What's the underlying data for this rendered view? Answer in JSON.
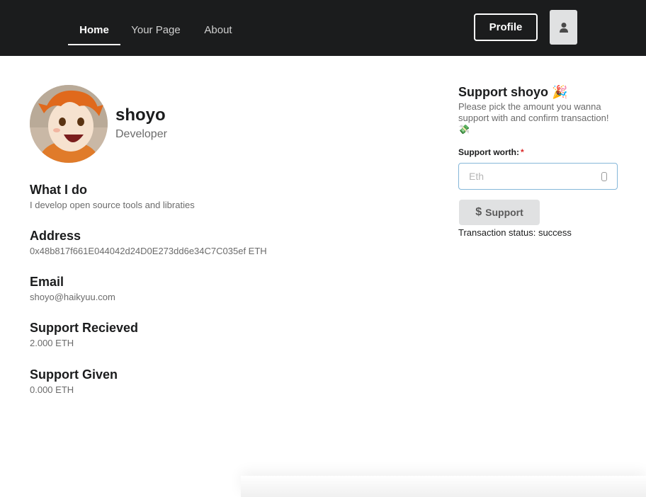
{
  "nav": {
    "items": [
      {
        "label": "Home",
        "active": true
      },
      {
        "label": "Your Page",
        "active": false
      },
      {
        "label": "About",
        "active": false
      }
    ],
    "profile_label": "Profile",
    "user_icon": "user-icon"
  },
  "profile": {
    "name": "shoyo",
    "role": "Developer",
    "avatar": "avatar-image"
  },
  "sections": [
    {
      "title": "What I do",
      "value": "I develop open source tools and libraties"
    },
    {
      "title": "Address",
      "value": "0x48b817f661E044042d24D0E273dd6e34C7C035ef ETH"
    },
    {
      "title": "Email",
      "value": "shoyo@haikyuu.com"
    },
    {
      "title": "Support Recieved",
      "value": "2.000 ETH"
    },
    {
      "title": "Support Given",
      "value": "0.000 ETH"
    }
  ],
  "support": {
    "title": "Support shoyo 🎉",
    "description": "Please pick the amount you wanna support with and confirm transaction! 💸",
    "field_label": "Support worth:",
    "required_mark": "*",
    "input_placeholder": "Eth",
    "input_value": "",
    "button_label": "Support",
    "button_icon": "dollar-icon",
    "status_text": "Transaction status: success"
  },
  "colors": {
    "topbar": "#1b1c1d",
    "accent_border": "#85b7d9",
    "required": "#db2828",
    "button_bg": "#e0e1e2"
  }
}
